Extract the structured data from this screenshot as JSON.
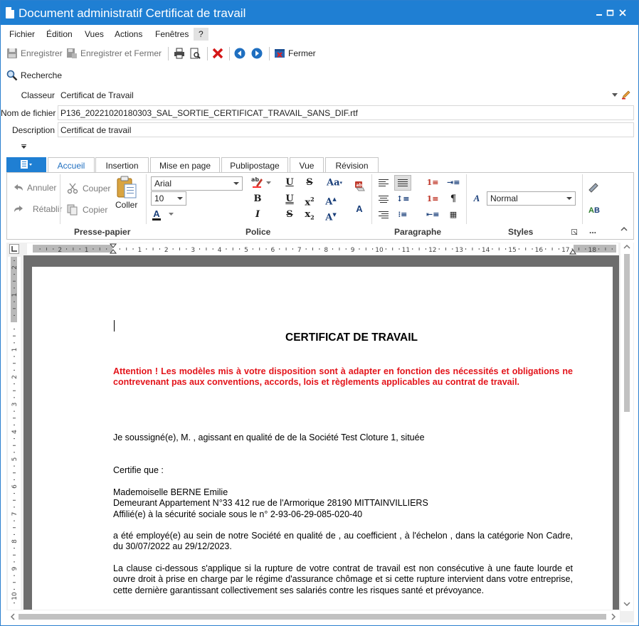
{
  "window": {
    "title": "Document administratif Certificat de travail"
  },
  "menu": {
    "items": [
      "Fichier",
      "Édition",
      "Vues",
      "Actions",
      "Fenêtres",
      "?"
    ]
  },
  "toolbar": {
    "save": "Enregistrer",
    "save_close": "Enregistrer et Fermer",
    "close": "Fermer"
  },
  "search": {
    "label": "Recherche"
  },
  "form": {
    "classeur_label": "Classeur",
    "classeur_value": "Certificat de Travail",
    "filename_label": "Nom de fichier",
    "filename_value": "P136_20221020180303_SAL_SORTIE_CERTIFICAT_TRAVAIL_SANS_DIF.rtf",
    "description_label": "Description",
    "description_value": "Certificat de travail"
  },
  "ribbon": {
    "tabs": [
      "Accueil",
      "Insertion",
      "Mise en page",
      "Publipostage",
      "Vue",
      "Révision"
    ],
    "active_tab": "Accueil",
    "undo": "Annuler",
    "redo": "Rétablir",
    "cut": "Couper",
    "copy": "Copier",
    "paste": "Coller",
    "font_name": "Arial",
    "font_size": "10",
    "style_value": "Normal",
    "groups": [
      "Presse-papier",
      "Police",
      "Paragraphe",
      "Styles"
    ],
    "more": "..."
  },
  "ruler": {
    "h_ticks": [
      "2",
      "1",
      "1",
      "2",
      "3",
      "4",
      "5",
      "6",
      "7",
      "8",
      "9",
      "10",
      "11",
      "12",
      "13",
      "14",
      "15",
      "16",
      "17",
      "18"
    ],
    "v_ticks": [
      "2",
      "1",
      "1",
      "2",
      "3",
      "4",
      "5",
      "6",
      "7",
      "8",
      "9",
      "10"
    ]
  },
  "document": {
    "title": "CERTIFICAT DE TRAVAIL",
    "warning": "Attention ! Les modèles mis à votre disposition sont à adapter en fonction des nécessités et obligations ne contrevenant pas aux conventions, accords, lois et règlements applicables au contrat de travail.",
    "p1": "Je soussigné(e), M. , agissant en qualité de  de la Société Test Cloture 1, située",
    "p2": "Certifie que :",
    "name": "Mademoiselle BERNE Emilie",
    "address": "Demeurant Appartement N°33 412 rue de l'Armorique  28190 MITTAINVILLIERS",
    "ssn": "Affilié(e) à la sécurité sociale sous le n° 2-93-06-29-085-020-40",
    "p3": "a été employé(e) au sein de notre Société  en qualité de , au coefficient , à l'échelon , dans la catégorie  Non Cadre, du 30/07/2022 au 29/12/2023.",
    "p4": "La clause ci-dessous s'applique si la rupture de votre contrat de travail est non consécutive à une faute lourde et ouvre droit à prise en charge par le régime d'assurance chômage et si cette rupture intervient dans votre entreprise, cette dernière garantissant collectivement ses salariés contre les risques santé et prévoyance."
  },
  "colors": {
    "accent": "#1f7fd3",
    "warning": "#e3141b"
  }
}
